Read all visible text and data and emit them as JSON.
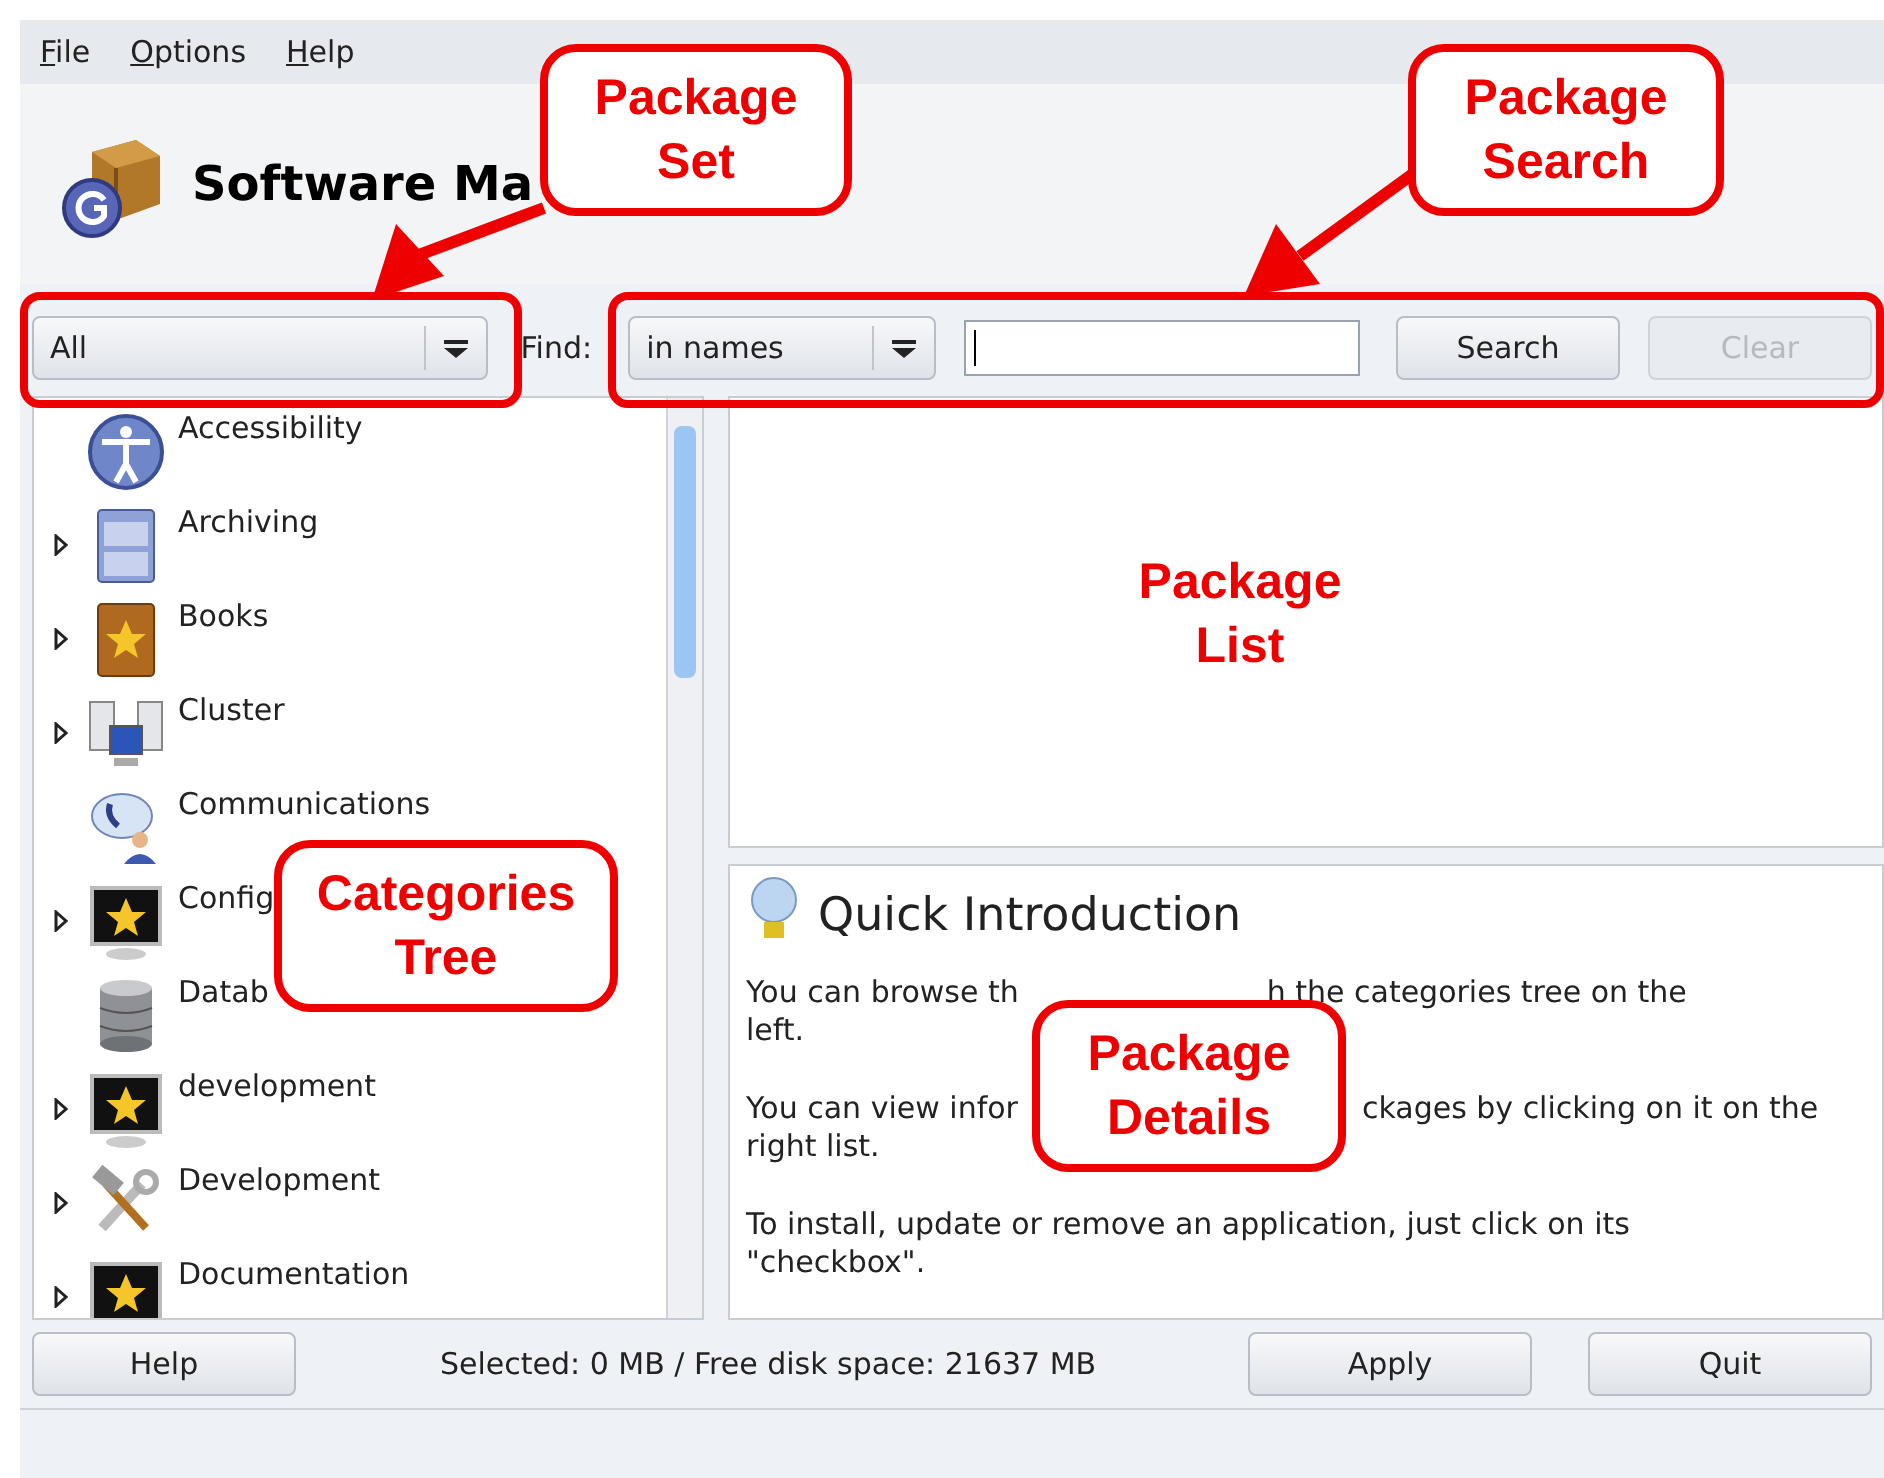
{
  "menu": [
    {
      "label": "File"
    },
    {
      "label": "Options"
    },
    {
      "label": "Help"
    }
  ],
  "header": {
    "title": "Software Ma"
  },
  "toolbar": {
    "package_set": {
      "value": "All"
    },
    "find_label": "Find:",
    "search_scope": {
      "value": "in names"
    },
    "buttons": [
      {
        "label": "Search",
        "disabled": false
      },
      {
        "label": "Clear",
        "disabled": true
      }
    ]
  },
  "categories": [
    {
      "label": "Accessibility",
      "expandable": false
    },
    {
      "label": "Archiving",
      "expandable": true
    },
    {
      "label": "Books",
      "expandable": true
    },
    {
      "label": "Cluster",
      "expandable": true
    },
    {
      "label": "Communications",
      "expandable": false
    },
    {
      "label": "Config",
      "expandable": true
    },
    {
      "label": "Datab",
      "expandable": false
    },
    {
      "label": "development",
      "expandable": true
    },
    {
      "label": "Development",
      "expandable": true
    },
    {
      "label": "Documentation",
      "expandable": true
    }
  ],
  "details": {
    "title": "Quick Introduction",
    "paragraphs": [
      {
        "lines": [
          [
            "You can browse th",
            "h the categories tree on the"
          ],
          [
            "left."
          ]
        ]
      },
      {
        "lines": [
          [
            "You can view infor",
            "ckages by clicking on it on the"
          ],
          [
            "right list."
          ]
        ]
      },
      {
        "lines": [
          [
            "To install, update or remove an application, just click on its"
          ],
          [
            "\"checkbox\"."
          ]
        ]
      }
    ]
  },
  "bottom": {
    "help": "Help",
    "status": "Selected: 0 MB / Free disk space: 21637 MB",
    "buttons": [
      {
        "label": "Apply"
      },
      {
        "label": "Quit"
      }
    ]
  },
  "annotations": [
    {
      "kind": "callout",
      "lines": [
        "Package",
        "Set"
      ]
    },
    {
      "kind": "callout",
      "lines": [
        "Package",
        "Search"
      ]
    },
    {
      "kind": "label",
      "lines": [
        "Package",
        "List"
      ]
    },
    {
      "kind": "callout",
      "lines": [
        "Categories",
        "Tree"
      ]
    },
    {
      "kind": "callout",
      "lines": [
        "Package",
        "Details"
      ]
    }
  ]
}
